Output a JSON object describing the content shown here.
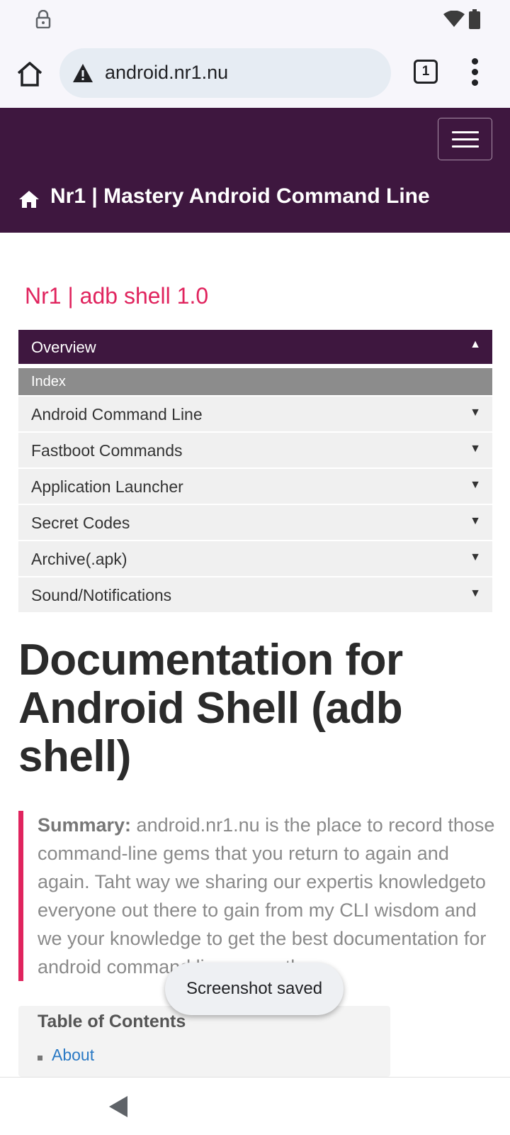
{
  "status_bar": {
    "icons": [
      "lock-icon",
      "wifi-icon",
      "battery-icon"
    ]
  },
  "browser": {
    "url": "android.nr1.nu",
    "tab_count": "1",
    "icons": [
      "home-icon",
      "warning-icon",
      "tabs-icon",
      "more-vert-icon"
    ]
  },
  "site_header": {
    "title": "Nr1 | Mastery Android Command Line",
    "colors": {
      "header_bg": "#3e173f"
    }
  },
  "sidebar": {
    "section_title": "Nr1 | adb shell 1.0",
    "overview_label": "Overview",
    "index_label": "Index",
    "items": [
      {
        "label": "Android Command Line"
      },
      {
        "label": "Fastboot Commands"
      },
      {
        "label": "Application Launcher"
      },
      {
        "label": "Secret Codes"
      },
      {
        "label": "Archive(.apk)"
      },
      {
        "label": "Sound/Notifications"
      }
    ],
    "arrow_up": "▲",
    "arrow_down": "▼"
  },
  "content": {
    "heading": "Documentation for Android Shell (adb shell)",
    "summary_label": "Summary:",
    "summary_text": " android.nr1.nu is the place to record those command-line gems that you return to again and again. Taht way we sharing our expertis knowledgeto everyone out there to gain from my CLI wisdom and we your knowledge to get the best documentation for android command line on earth..",
    "toc_title": "Table of Contents",
    "toc_items": [
      "About"
    ],
    "accent_color": "#e0245e"
  },
  "toast": {
    "text": "Screenshot saved"
  }
}
